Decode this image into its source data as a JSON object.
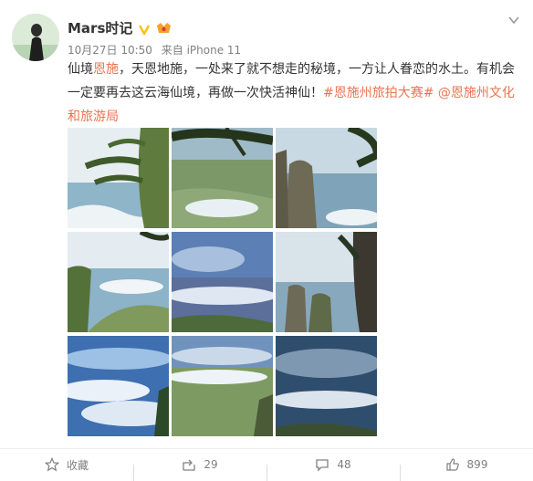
{
  "post": {
    "username": "Mars时记",
    "date": "10月27日 10:50",
    "source": "来自 iPhone 11",
    "text_parts": {
      "p1": "仙境",
      "link1": "恩施",
      "p2": "，天恩地施，一处来了就不想走的秘境，一方让人眷恋的水土。有机会一定要再去这云海仙境，再做一次快活神仙！",
      "hashtag": "#恩施州旅拍大赛#",
      "mention": "@恩施州文化和旅游局"
    },
    "photos": [
      {
        "label": "pine-cliff-valley"
      },
      {
        "label": "pine-over-town"
      },
      {
        "label": "pinnacle-rocks"
      },
      {
        "label": "cliff-valley-clouds"
      },
      {
        "label": "blue-sky-cloud-sea"
      },
      {
        "label": "rock-pillars-cliff"
      },
      {
        "label": "sea-of-clouds"
      },
      {
        "label": "valley-town-clouds"
      },
      {
        "label": "dark-cloud-sea"
      }
    ]
  },
  "footer": {
    "favorite_label": "收藏",
    "repost_count": "29",
    "comment_count": "48",
    "like_count": "899"
  },
  "colors": {
    "link": "#eb7350",
    "verified": "#ffc107",
    "meta": "#808080"
  }
}
